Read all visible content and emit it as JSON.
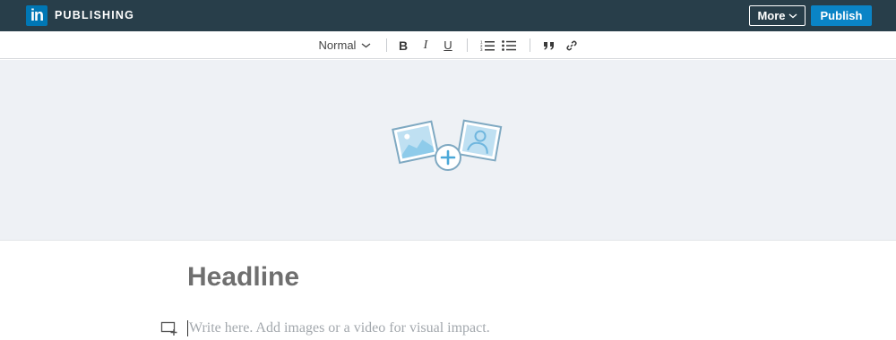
{
  "topbar": {
    "logo_text": "in",
    "brand": "PUBLISHING",
    "more_label": "More",
    "publish_label": "Publish",
    "background": "#283e4a",
    "accent": "#0a84c6"
  },
  "toolbar": {
    "text_style": "Normal",
    "icons": [
      "bold-icon",
      "italic-icon",
      "underline-icon",
      "numbered-list-icon",
      "bulleted-list-icon",
      "quote-icon",
      "link-icon"
    ],
    "bold_glyph": "B",
    "italic_glyph": "I",
    "underline_glyph": "U",
    "quote_glyph": "”"
  },
  "cover": {
    "icon": "add-image-icon",
    "background": "#eef1f5"
  },
  "editor": {
    "headline_placeholder": "Headline",
    "body_placeholder": "Write here. Add images or a video for visual impact.",
    "add_media_icon": "add-media-icon"
  }
}
